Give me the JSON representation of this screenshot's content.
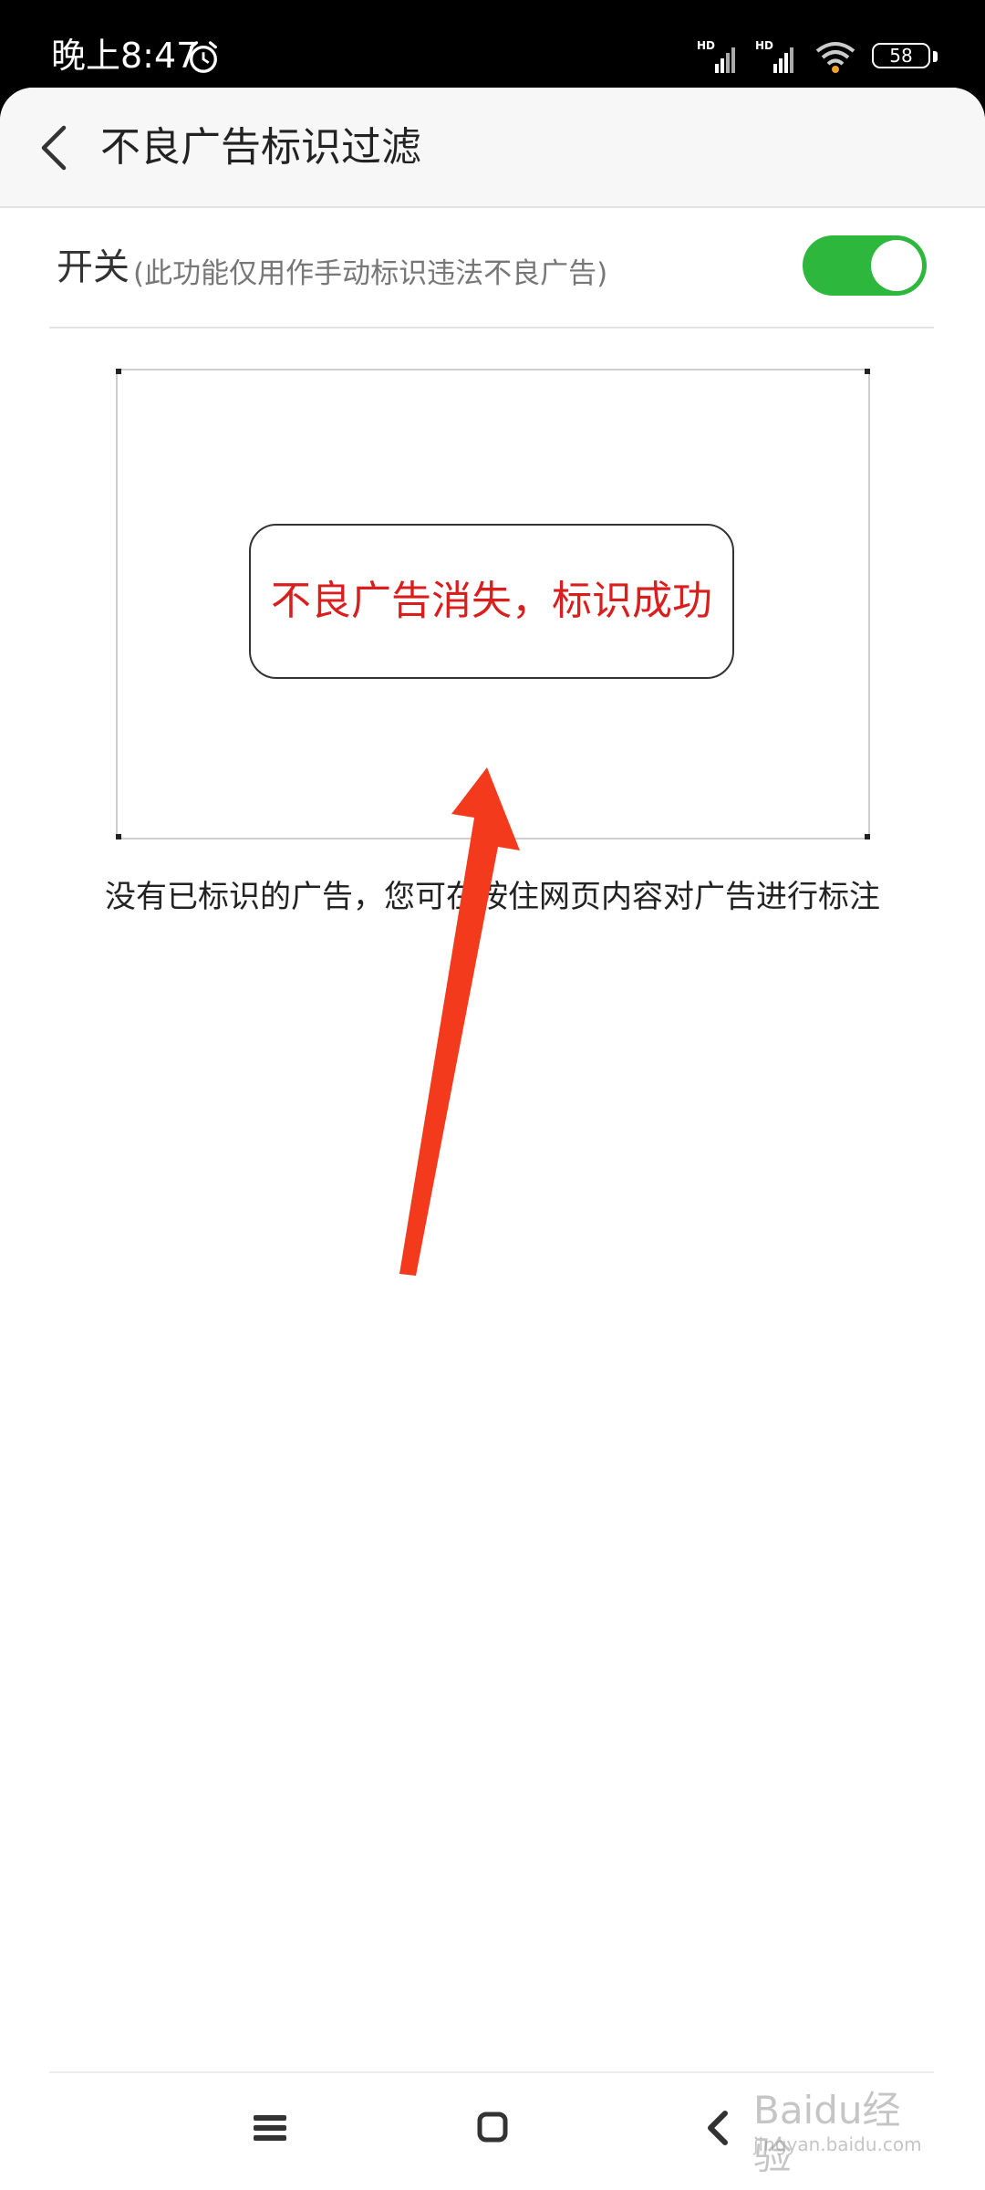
{
  "status_bar": {
    "time": "晚上8:47",
    "battery": "58",
    "network_label": "HD",
    "icons": [
      "alarm-icon",
      "signal-icon",
      "signal-icon",
      "wifi-icon",
      "battery-icon"
    ]
  },
  "header": {
    "title": "不良广告标识过滤",
    "back_icon": "chevron-left-icon"
  },
  "settings": {
    "switch_label": "开关",
    "switch_hint": "(此功能仅用作手动标识违法不良广告)",
    "switch_on": true,
    "accent_color": "#2db83d"
  },
  "preview": {
    "message": "不良广告消失，标识成功",
    "message_color": "#d91e1e"
  },
  "empty_state": {
    "text": "没有已标识的广告，您可在按住网页内容对广告进行标注"
  },
  "annotation": {
    "arrow_color": "#f43a1c"
  },
  "nav_bar": {
    "icons": [
      "menu-icon",
      "home-icon",
      "back-icon"
    ]
  },
  "watermark": {
    "text": "Baidu经验",
    "sub": "jingyan.baidu.com"
  }
}
